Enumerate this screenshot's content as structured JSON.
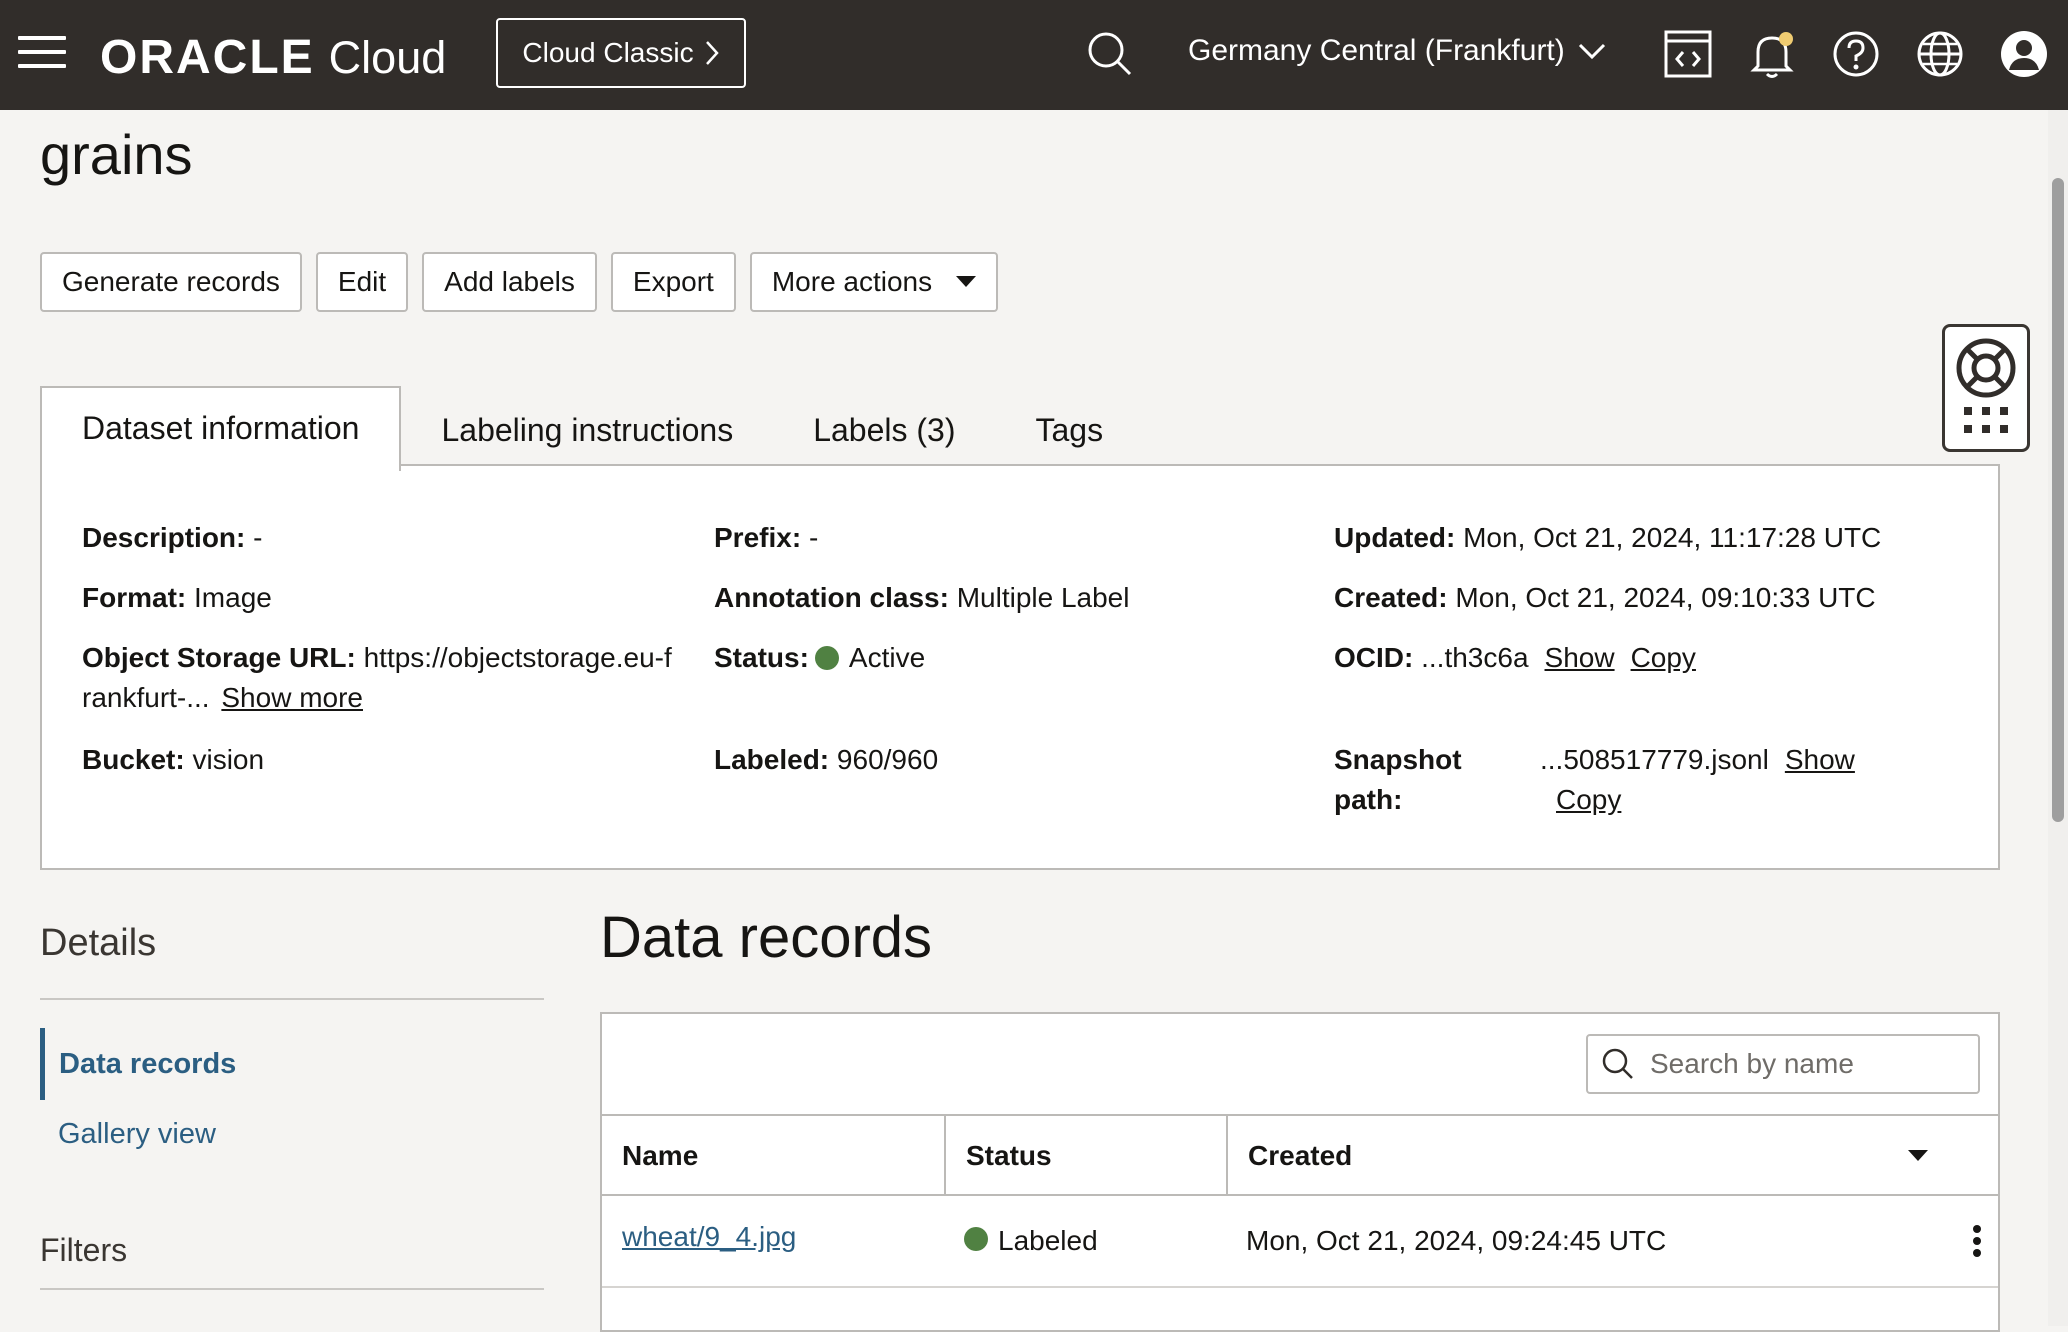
{
  "header": {
    "brand": "ORACLE",
    "product": "Cloud",
    "classic_button": "Cloud Classic",
    "region": "Germany Central (Frankfurt)",
    "notification_color": "#f0cc71"
  },
  "page": {
    "title": "grains",
    "actions": [
      "Generate records",
      "Edit",
      "Add labels",
      "Export",
      "More actions"
    ]
  },
  "tabs": [
    "Dataset information",
    "Labeling instructions",
    "Labels (3)",
    "Tags"
  ],
  "info": {
    "description_label": "Description:",
    "description": "-",
    "format_label": "Format:",
    "format": "Image",
    "url_label": "Object Storage URL:",
    "url_line1": "https://objectstorage.eu-f",
    "url_line2": "rankfurt-...",
    "url_show_more": "Show more",
    "bucket_label": "Bucket:",
    "bucket": "vision",
    "prefix_label": "Prefix:",
    "prefix": "-",
    "annotation_label": "Annotation class:",
    "annotation": "Multiple Label",
    "status_label": "Status:",
    "status": "Active",
    "labeled_label": "Labeled:",
    "labeled": "960/960",
    "updated_label": "Updated:",
    "updated": "Mon, Oct 21, 2024, 11:17:28 UTC",
    "created_label": "Created:",
    "created": "Mon, Oct 21, 2024, 09:10:33 UTC",
    "ocid_label": "OCID:",
    "ocid": "...th3c6a",
    "show": "Show",
    "copy": "Copy",
    "snapshot_label_1": "Snapshot",
    "snapshot_label_2": "path:",
    "snapshot": "...508517779.jsonl"
  },
  "sidebar": {
    "details_title": "Details",
    "items": [
      "Data records",
      "Gallery view"
    ],
    "filters_title": "Filters"
  },
  "records": {
    "title": "Data records",
    "search_placeholder": "Search by name",
    "columns": [
      "Name",
      "Status",
      "Created"
    ],
    "rows": [
      {
        "name": "wheat/9_4.jpg",
        "status": "Labeled",
        "created": "Mon, Oct 21, 2024, 09:24:45 UTC"
      }
    ],
    "status_color": "#508142"
  }
}
